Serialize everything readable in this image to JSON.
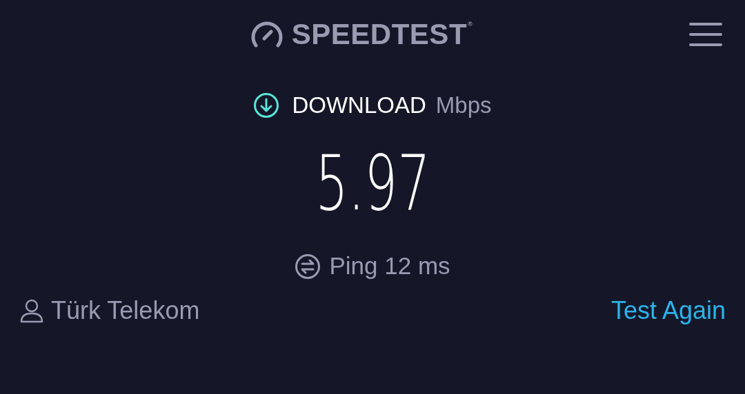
{
  "header": {
    "logo": "SPEEDTEST",
    "logo_mark": "®"
  },
  "result": {
    "label": "DOWNLOAD",
    "unit": "Mbps",
    "value": "5.97"
  },
  "ping": {
    "text": "Ping 12 ms"
  },
  "footer": {
    "provider": "Türk Telekom",
    "action": "Test Again"
  }
}
